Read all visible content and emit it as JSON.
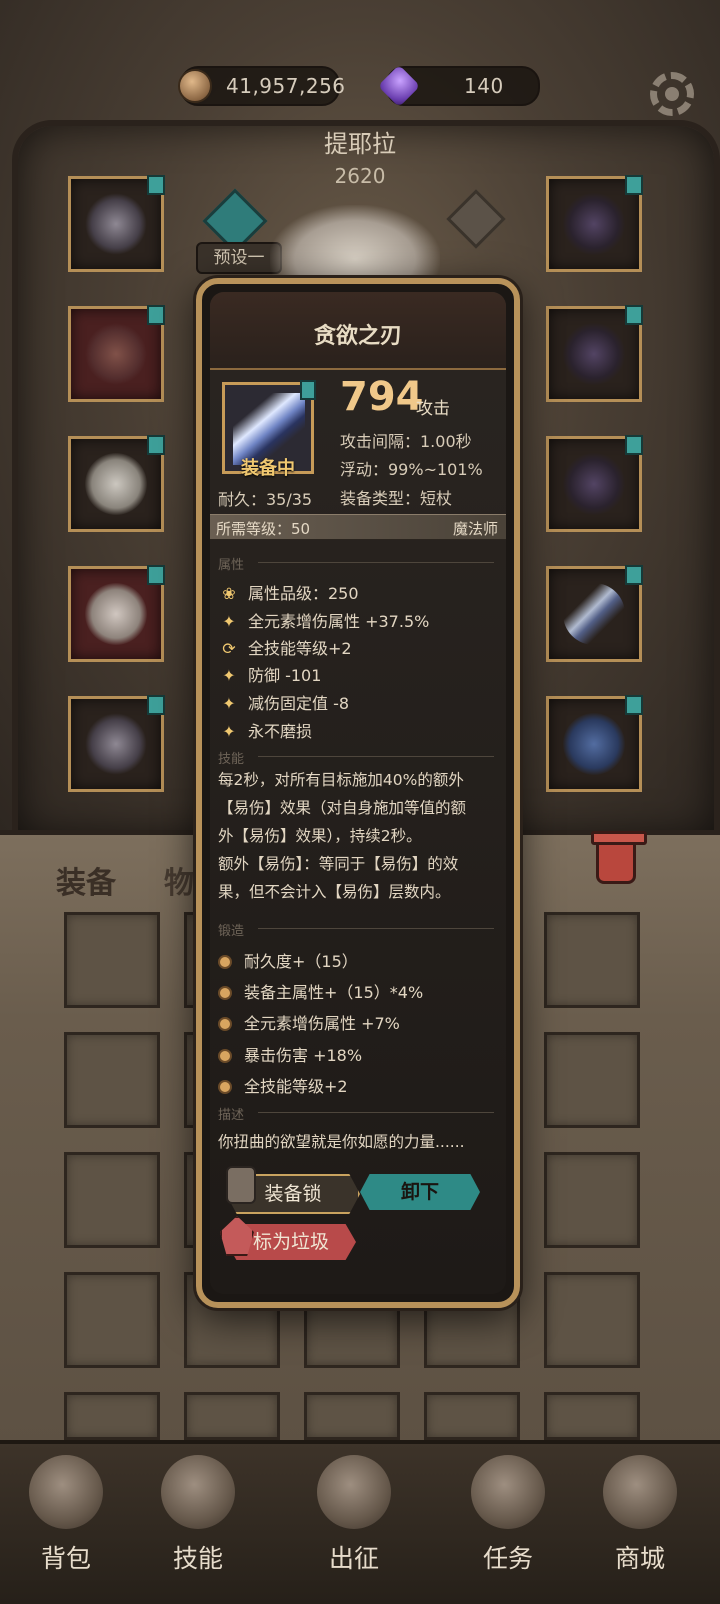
{
  "currency": {
    "gold": "41,957,256",
    "gems": "140",
    "gold_icon": "coin-icon",
    "gem_icon": "gem-icon"
  },
  "hero": {
    "name": "提耶拉",
    "power": "2620",
    "preset": "预设一"
  },
  "tabs": {
    "equip": "装备",
    "items": "物品"
  },
  "item": {
    "name": "贪欲之刃",
    "equipped_label": "装备中",
    "power": "794",
    "power_unit": "攻击",
    "attack_interval": "攻击间隔：1.00秒",
    "float": "浮动：99%~101%",
    "type": "装备类型：短杖",
    "durability": "耐久：35/35",
    "required_level": "所需等级：50",
    "class": "魔法师",
    "sections": {
      "attributes": "属性",
      "skill": "技能",
      "forge": "锻造",
      "description": "描述"
    },
    "attributes": [
      {
        "icon": "lotus-icon",
        "text": "属性品级：250"
      },
      {
        "icon": "star-icon",
        "text": "全元素增伤属性 +37.5%"
      },
      {
        "icon": "refresh-icon",
        "text": "全技能等级+2"
      },
      {
        "icon": "star-icon",
        "text": "防御 -101"
      },
      {
        "icon": "star-icon",
        "text": "减伤固定值 -8"
      },
      {
        "icon": "star-icon",
        "text": "永不磨损"
      }
    ],
    "skill_text": [
      "每2秒，对所有目标施加40%的额外",
      "【易伤】效果（对自身施加等值的额",
      "外【易伤】效果），持续2秒。",
      "额外【易伤】：等同于【易伤】的效",
      "果，但不会计入【易伤】层数内。"
    ],
    "forge": [
      "耐久度+（15）",
      "装备主属性+（15）*4%",
      "全元素增伤属性 +7%",
      "暴击伤害 +18%",
      "全技能等级+2"
    ],
    "description": "你扭曲的欲望就是你如愿的力量......",
    "buttons": {
      "lock": "装备锁",
      "unequip": "卸下",
      "mark_trash": "标为垃圾"
    }
  },
  "nav": [
    {
      "label": "背包",
      "icon": "backpack-icon"
    },
    {
      "label": "技能",
      "icon": "skill-book-icon"
    },
    {
      "label": "出征",
      "icon": "battle-icon"
    },
    {
      "label": "任务",
      "icon": "scroll-icon"
    },
    {
      "label": "商城",
      "icon": "shop-icon"
    }
  ]
}
